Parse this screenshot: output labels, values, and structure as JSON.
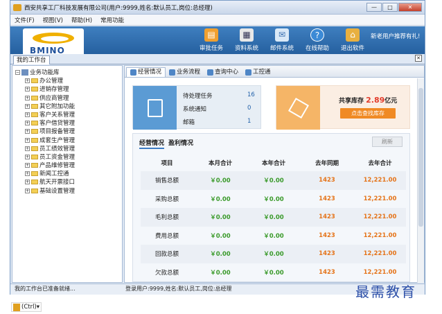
{
  "window": {
    "title": "西安共享工厂科技发展有限公司(用户:9999,姓名:默认员工,岗位:总经理)",
    "min": "—",
    "max": "□",
    "close": "✕"
  },
  "menu": [
    "文件(F)",
    "视图(V)",
    "帮助(H)",
    "常用功能"
  ],
  "logo": {
    "text": "BMINO"
  },
  "toolbar": [
    {
      "label": "审批任务",
      "icon": "document-icon",
      "color": "#f0a030"
    },
    {
      "label": "资料系统",
      "icon": "card-icon",
      "color": "#e8e8e8"
    },
    {
      "label": "邮件系统",
      "icon": "mail-icon",
      "color": "#d9e9f7"
    },
    {
      "label": "在线帮助",
      "icon": "help-icon",
      "color": "#3b8ad6"
    },
    {
      "label": "退出软件",
      "icon": "exit-icon",
      "color": "#e8b040"
    }
  ],
  "recommend": "新老用户推荐有礼!",
  "workbench_tab": "我的工作台",
  "tree": {
    "root": "业务功能库",
    "items": [
      "办公管理",
      "进销存管理",
      "供应商管理",
      "其它附加功能",
      "客户关系管理",
      "客户借贷管理",
      "项目报备管理",
      "成套生产管理",
      "员工绩效管理",
      "员工资金管理",
      "产品维修管理",
      "新闻工控通",
      "航天开票接口",
      "基础设置管理"
    ]
  },
  "subtabs": [
    "经营情况",
    "业务流程",
    "查询中心",
    "工控通"
  ],
  "tasks": [
    {
      "label": "待处理任务",
      "value": "16"
    },
    {
      "label": "系统通知",
      "value": "0"
    },
    {
      "label": "邮箱",
      "value": "1"
    }
  ],
  "stock": {
    "prefix": "共享库存",
    "amount": "2.89",
    "unit": "亿元",
    "button": "点击查找库存"
  },
  "panel": {
    "tab_active": "经营情况",
    "tab_other": "盈利情况",
    "refresh": "刷新"
  },
  "table": {
    "headers": [
      "项目",
      "本月合计",
      "本年合计",
      "去年同期",
      "去年合计"
    ],
    "rows": [
      [
        "销售总额",
        "￥0.00",
        "￥0.00",
        "1423",
        "12,221.00"
      ],
      [
        "采购总额",
        "￥0.00",
        "￥0.00",
        "1423",
        "12,221.00"
      ],
      [
        "毛利总额",
        "￥0.00",
        "￥0.00",
        "1423",
        "12,221.00"
      ],
      [
        "费用总额",
        "￥0.00",
        "￥0.00",
        "1423",
        "12,221.00"
      ],
      [
        "回款总额",
        "￥0.00",
        "￥0.00",
        "1423",
        "12,221.00"
      ],
      [
        "欠款总额",
        "￥0.00",
        "￥0.00",
        "1423",
        "12,221.00"
      ]
    ]
  },
  "status": {
    "left": "我的工作台已准备就绪...",
    "right": "登录用户:9999,姓名:默认员工,岗位:总经理"
  },
  "watermark": "最需教育",
  "paste": "(Ctrl)▾"
}
